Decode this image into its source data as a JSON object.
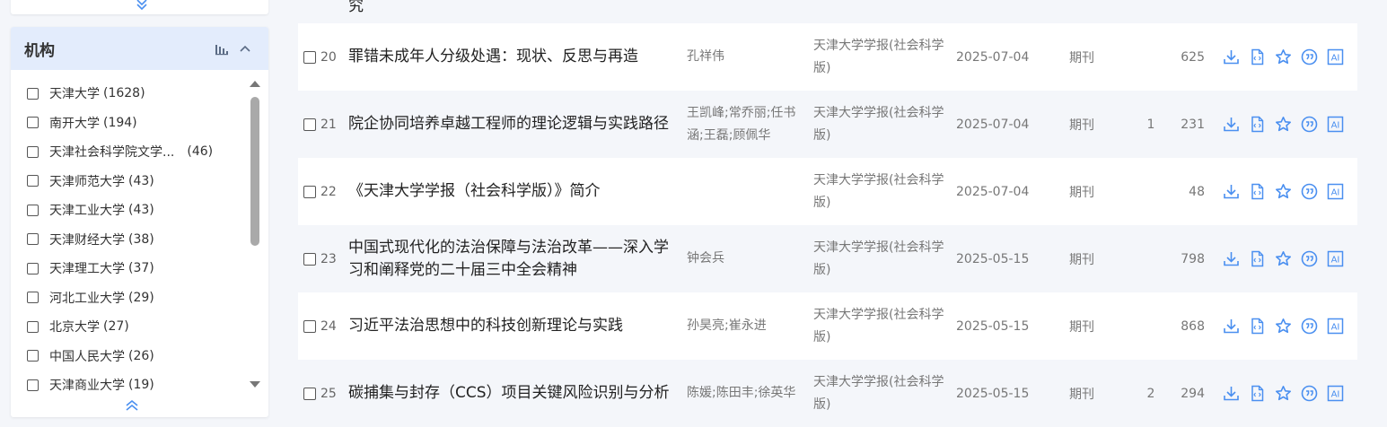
{
  "facet": {
    "title": "机构",
    "items": [
      {
        "name": "天津大学",
        "count": "(1628)"
      },
      {
        "name": "南开大学",
        "count": "(194)"
      },
      {
        "name": "天津社会科学院文学...",
        "count": "(46)"
      },
      {
        "name": "天津师范大学",
        "count": "(43)"
      },
      {
        "name": "天津工业大学",
        "count": "(43)"
      },
      {
        "name": "天津财经大学",
        "count": "(38)"
      },
      {
        "name": "天津理工大学",
        "count": "(37)"
      },
      {
        "name": "河北工业大学",
        "count": "(29)"
      },
      {
        "name": "北京大学",
        "count": "(27)"
      },
      {
        "name": "中国人民大学",
        "count": "(26)"
      },
      {
        "name": "天津商业大学",
        "count": "(19)"
      }
    ]
  },
  "results": {
    "top_fragment": "究",
    "rows": [
      {
        "num": "20",
        "title": "罪错未成年人分级处遇：现状、反思与再造",
        "authors": "孔祥伟",
        "source": "天津大学学报(社会科学版)",
        "date": "2025-07-04",
        "type": "期刊",
        "cited": "",
        "downloads": "625"
      },
      {
        "num": "21",
        "title": "院企协同培养卓越工程师的理论逻辑与实践路径",
        "authors": "王凯峰;常乔丽;任书涵;王磊;顾佩华",
        "source": "天津大学学报(社会科学版)",
        "date": "2025-07-04",
        "type": "期刊",
        "cited": "1",
        "downloads": "231"
      },
      {
        "num": "22",
        "title": "《天津大学学报（社会科学版）》简介",
        "authors": "",
        "source": "天津大学学报(社会科学版)",
        "date": "2025-07-04",
        "type": "期刊",
        "cited": "",
        "downloads": "48"
      },
      {
        "num": "23",
        "title": "中国式现代化的法治保障与法治改革——深入学习和阐释党的二十届三中全会精神",
        "authors": "钟会兵",
        "source": "天津大学学报(社会科学版)",
        "date": "2025-05-15",
        "type": "期刊",
        "cited": "",
        "downloads": "798"
      },
      {
        "num": "24",
        "title": "习近平法治思想中的科技创新理论与实践",
        "authors": "孙昊亮;崔永进",
        "source": "天津大学学报(社会科学版)",
        "date": "2025-05-15",
        "type": "期刊",
        "cited": "",
        "downloads": "868"
      },
      {
        "num": "25",
        "title": "碳捕集与封存（CCS）项目关键风险识别与分析",
        "authors": "陈媛;陈田丰;徐英华",
        "source": "天津大学学报(社会科学版)",
        "date": "2025-05-15",
        "type": "期刊",
        "cited": "2",
        "downloads": "294"
      }
    ],
    "op_icons": [
      "download-icon",
      "html-read-icon",
      "favorite-star-icon",
      "quote-icon",
      "ai-icon"
    ],
    "op_ai_label": "AI"
  },
  "colors": {
    "accent": "#4a8ff0",
    "facet_header_bg": "#e3ecfc",
    "row_alt_bg": "#f4f6fa"
  }
}
